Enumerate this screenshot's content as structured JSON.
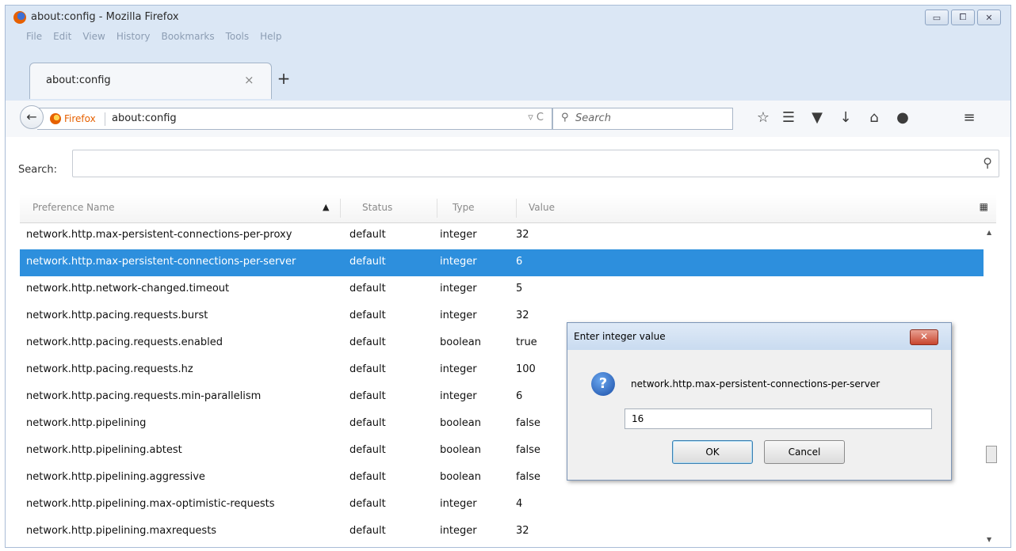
{
  "window": {
    "title": "about:config - Mozilla Firefox",
    "buttons": {
      "minimize": "▭",
      "maximize": "⧠",
      "close": "✕"
    }
  },
  "menubar": [
    "File",
    "Edit",
    "View",
    "History",
    "Bookmarks",
    "Tools",
    "Help"
  ],
  "tab": {
    "label": "about:config",
    "close": "×",
    "new_tab": "+"
  },
  "navbar": {
    "back": "←",
    "identity": "Firefox",
    "url": "about:config",
    "url_tools": "▿ C",
    "search_placeholder": "Search",
    "toolbar_icons": [
      "star-icon",
      "reading-list-icon",
      "pocket-icon",
      "download-icon",
      "home-icon",
      "hello-icon",
      "menu-icon"
    ]
  },
  "config": {
    "search_label": "Search:",
    "search_value": "",
    "columns": {
      "name": "Preference Name",
      "status": "Status",
      "type": "Type",
      "value": "Value"
    },
    "sort_indicator": "▲",
    "rows": [
      {
        "name": "network.http.max-persistent-connections-per-proxy",
        "status": "default",
        "type": "integer",
        "value": "32",
        "selected": false
      },
      {
        "name": "network.http.max-persistent-connections-per-server",
        "status": "default",
        "type": "integer",
        "value": "6",
        "selected": true
      },
      {
        "name": "network.http.network-changed.timeout",
        "status": "default",
        "type": "integer",
        "value": "5",
        "selected": false
      },
      {
        "name": "network.http.pacing.requests.burst",
        "status": "default",
        "type": "integer",
        "value": "32",
        "selected": false
      },
      {
        "name": "network.http.pacing.requests.enabled",
        "status": "default",
        "type": "boolean",
        "value": "true",
        "selected": false
      },
      {
        "name": "network.http.pacing.requests.hz",
        "status": "default",
        "type": "integer",
        "value": "100",
        "selected": false
      },
      {
        "name": "network.http.pacing.requests.min-parallelism",
        "status": "default",
        "type": "integer",
        "value": "6",
        "selected": false
      },
      {
        "name": "network.http.pipelining",
        "status": "default",
        "type": "boolean",
        "value": "false",
        "selected": false
      },
      {
        "name": "network.http.pipelining.abtest",
        "status": "default",
        "type": "boolean",
        "value": "false",
        "selected": false
      },
      {
        "name": "network.http.pipelining.aggressive",
        "status": "default",
        "type": "boolean",
        "value": "false",
        "selected": false
      },
      {
        "name": "network.http.pipelining.max-optimistic-requests",
        "status": "default",
        "type": "integer",
        "value": "4",
        "selected": false
      },
      {
        "name": "network.http.pipelining.maxrequests",
        "status": "default",
        "type": "integer",
        "value": "32",
        "selected": false
      }
    ]
  },
  "dialog": {
    "title": "Enter integer value",
    "close": "✕",
    "message": "network.http.max-persistent-connections-per-server",
    "input_value": "16",
    "ok": "OK",
    "cancel": "Cancel"
  },
  "colors": {
    "selection": "#2d8fdd",
    "chrome": "#dbe7f5"
  }
}
